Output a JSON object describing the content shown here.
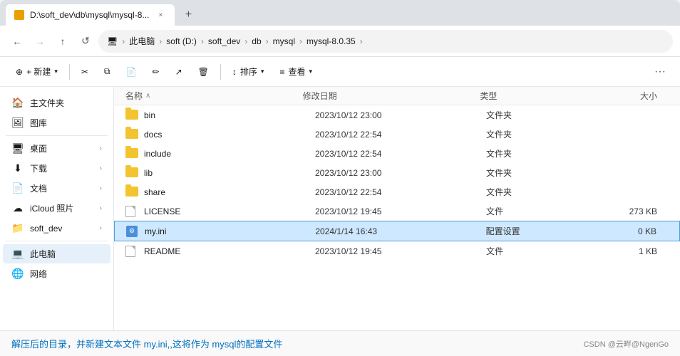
{
  "browser": {
    "tab": {
      "title": "D:\\soft_dev\\db\\mysql\\mysql-8...",
      "close": "×"
    },
    "new_tab_label": "+",
    "nav": {
      "back": "←",
      "forward": "→",
      "up": "↑",
      "refresh": "↺",
      "computer_icon": "🖥",
      "breadcrumbs": [
        "此电脑",
        "soft (D:)",
        "soft_dev",
        "db",
        "mysql",
        "mysql-8.0.35"
      ],
      "breadcrumb_more": ">"
    },
    "toolbar": {
      "new_label": "+ 新建",
      "cut_icon": "✂",
      "copy_icon": "⧉",
      "paste_icon": "📋",
      "rename_icon": "✏",
      "share_icon": "↗",
      "delete_icon": "🗑",
      "sort_label": "↕ 排序",
      "view_label": "≡ 查看",
      "more_label": "···"
    }
  },
  "sidebar": {
    "items": [
      {
        "id": "home",
        "icon": "🏠",
        "label": "主文件夹",
        "arrow": ""
      },
      {
        "id": "gallery",
        "icon": "🖼",
        "label": "图库",
        "arrow": ""
      },
      {
        "id": "desktop",
        "icon": "🖥",
        "label": "桌面",
        "arrow": "›"
      },
      {
        "id": "downloads",
        "icon": "⬇",
        "label": "下载",
        "arrow": "›"
      },
      {
        "id": "documents",
        "icon": "📄",
        "label": "文档",
        "arrow": "›"
      },
      {
        "id": "icloud",
        "icon": "☁",
        "label": "iCloud 照片",
        "arrow": "›"
      },
      {
        "id": "softdev",
        "icon": "📁",
        "label": "soft_dev",
        "arrow": "›"
      }
    ],
    "divider1": true,
    "bottom_items": [
      {
        "id": "thispc",
        "icon": "💻",
        "label": "此电脑",
        "selected": true
      },
      {
        "id": "network",
        "icon": "🌐",
        "label": "网络"
      }
    ]
  },
  "file_list": {
    "columns": {
      "name": "名称",
      "date": "修改日期",
      "type": "类型",
      "size": "大小"
    },
    "sort_arrow": "∧",
    "files": [
      {
        "id": "bin",
        "type": "folder",
        "name": "bin",
        "date": "2023/10/12 23:00",
        "filetype": "文件夹",
        "size": ""
      },
      {
        "id": "docs",
        "type": "folder",
        "name": "docs",
        "date": "2023/10/12 22:54",
        "filetype": "文件夹",
        "size": ""
      },
      {
        "id": "include",
        "type": "folder",
        "name": "include",
        "date": "2023/10/12 22:54",
        "filetype": "文件夹",
        "size": ""
      },
      {
        "id": "lib",
        "type": "folder",
        "name": "lib",
        "date": "2023/10/12 23:00",
        "filetype": "文件夹",
        "size": ""
      },
      {
        "id": "share",
        "type": "folder",
        "name": "share",
        "date": "2023/10/12 22:54",
        "filetype": "文件夹",
        "size": ""
      },
      {
        "id": "license",
        "type": "file",
        "name": "LICENSE",
        "date": "2023/10/12 19:45",
        "filetype": "文件",
        "size": "273 KB"
      },
      {
        "id": "myini",
        "type": "ini",
        "name": "my.ini",
        "date": "2024/1/14 16:43",
        "filetype": "配置设置",
        "size": "0 KB",
        "selected": true
      },
      {
        "id": "readme",
        "type": "file",
        "name": "README",
        "date": "2023/10/12 19:45",
        "filetype": "文件",
        "size": "1 KB"
      }
    ]
  },
  "bottom": {
    "annotation": "解压后的目录，并新建文本文件  my.ini,,这将作为 mysql的配置文件",
    "credit": "CSDN @云畔@NgenGo"
  }
}
